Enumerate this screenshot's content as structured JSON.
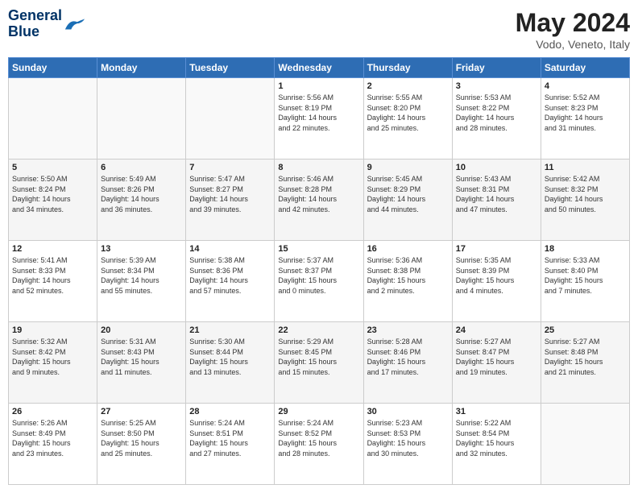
{
  "header": {
    "logo_general": "General",
    "logo_blue": "Blue",
    "main_title": "May 2024",
    "subtitle": "Vodo, Veneto, Italy"
  },
  "days_of_week": [
    "Sunday",
    "Monday",
    "Tuesday",
    "Wednesday",
    "Thursday",
    "Friday",
    "Saturday"
  ],
  "weeks": [
    [
      {
        "day": "",
        "info": ""
      },
      {
        "day": "",
        "info": ""
      },
      {
        "day": "",
        "info": ""
      },
      {
        "day": "1",
        "info": "Sunrise: 5:56 AM\nSunset: 8:19 PM\nDaylight: 14 hours\nand 22 minutes."
      },
      {
        "day": "2",
        "info": "Sunrise: 5:55 AM\nSunset: 8:20 PM\nDaylight: 14 hours\nand 25 minutes."
      },
      {
        "day": "3",
        "info": "Sunrise: 5:53 AM\nSunset: 8:22 PM\nDaylight: 14 hours\nand 28 minutes."
      },
      {
        "day": "4",
        "info": "Sunrise: 5:52 AM\nSunset: 8:23 PM\nDaylight: 14 hours\nand 31 minutes."
      }
    ],
    [
      {
        "day": "5",
        "info": "Sunrise: 5:50 AM\nSunset: 8:24 PM\nDaylight: 14 hours\nand 34 minutes."
      },
      {
        "day": "6",
        "info": "Sunrise: 5:49 AM\nSunset: 8:26 PM\nDaylight: 14 hours\nand 36 minutes."
      },
      {
        "day": "7",
        "info": "Sunrise: 5:47 AM\nSunset: 8:27 PM\nDaylight: 14 hours\nand 39 minutes."
      },
      {
        "day": "8",
        "info": "Sunrise: 5:46 AM\nSunset: 8:28 PM\nDaylight: 14 hours\nand 42 minutes."
      },
      {
        "day": "9",
        "info": "Sunrise: 5:45 AM\nSunset: 8:29 PM\nDaylight: 14 hours\nand 44 minutes."
      },
      {
        "day": "10",
        "info": "Sunrise: 5:43 AM\nSunset: 8:31 PM\nDaylight: 14 hours\nand 47 minutes."
      },
      {
        "day": "11",
        "info": "Sunrise: 5:42 AM\nSunset: 8:32 PM\nDaylight: 14 hours\nand 50 minutes."
      }
    ],
    [
      {
        "day": "12",
        "info": "Sunrise: 5:41 AM\nSunset: 8:33 PM\nDaylight: 14 hours\nand 52 minutes."
      },
      {
        "day": "13",
        "info": "Sunrise: 5:39 AM\nSunset: 8:34 PM\nDaylight: 14 hours\nand 55 minutes."
      },
      {
        "day": "14",
        "info": "Sunrise: 5:38 AM\nSunset: 8:36 PM\nDaylight: 14 hours\nand 57 minutes."
      },
      {
        "day": "15",
        "info": "Sunrise: 5:37 AM\nSunset: 8:37 PM\nDaylight: 15 hours\nand 0 minutes."
      },
      {
        "day": "16",
        "info": "Sunrise: 5:36 AM\nSunset: 8:38 PM\nDaylight: 15 hours\nand 2 minutes."
      },
      {
        "day": "17",
        "info": "Sunrise: 5:35 AM\nSunset: 8:39 PM\nDaylight: 15 hours\nand 4 minutes."
      },
      {
        "day": "18",
        "info": "Sunrise: 5:33 AM\nSunset: 8:40 PM\nDaylight: 15 hours\nand 7 minutes."
      }
    ],
    [
      {
        "day": "19",
        "info": "Sunrise: 5:32 AM\nSunset: 8:42 PM\nDaylight: 15 hours\nand 9 minutes."
      },
      {
        "day": "20",
        "info": "Sunrise: 5:31 AM\nSunset: 8:43 PM\nDaylight: 15 hours\nand 11 minutes."
      },
      {
        "day": "21",
        "info": "Sunrise: 5:30 AM\nSunset: 8:44 PM\nDaylight: 15 hours\nand 13 minutes."
      },
      {
        "day": "22",
        "info": "Sunrise: 5:29 AM\nSunset: 8:45 PM\nDaylight: 15 hours\nand 15 minutes."
      },
      {
        "day": "23",
        "info": "Sunrise: 5:28 AM\nSunset: 8:46 PM\nDaylight: 15 hours\nand 17 minutes."
      },
      {
        "day": "24",
        "info": "Sunrise: 5:27 AM\nSunset: 8:47 PM\nDaylight: 15 hours\nand 19 minutes."
      },
      {
        "day": "25",
        "info": "Sunrise: 5:27 AM\nSunset: 8:48 PM\nDaylight: 15 hours\nand 21 minutes."
      }
    ],
    [
      {
        "day": "26",
        "info": "Sunrise: 5:26 AM\nSunset: 8:49 PM\nDaylight: 15 hours\nand 23 minutes."
      },
      {
        "day": "27",
        "info": "Sunrise: 5:25 AM\nSunset: 8:50 PM\nDaylight: 15 hours\nand 25 minutes."
      },
      {
        "day": "28",
        "info": "Sunrise: 5:24 AM\nSunset: 8:51 PM\nDaylight: 15 hours\nand 27 minutes."
      },
      {
        "day": "29",
        "info": "Sunrise: 5:24 AM\nSunset: 8:52 PM\nDaylight: 15 hours\nand 28 minutes."
      },
      {
        "day": "30",
        "info": "Sunrise: 5:23 AM\nSunset: 8:53 PM\nDaylight: 15 hours\nand 30 minutes."
      },
      {
        "day": "31",
        "info": "Sunrise: 5:22 AM\nSunset: 8:54 PM\nDaylight: 15 hours\nand 32 minutes."
      },
      {
        "day": "",
        "info": ""
      }
    ]
  ]
}
